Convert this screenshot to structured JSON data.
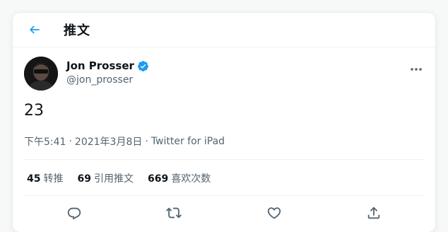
{
  "header": {
    "title": "推文"
  },
  "author": {
    "display_name": "Jon Prosser",
    "handle": "@jon_prosser",
    "verified": true
  },
  "tweet": {
    "text": "23",
    "time": "下午5:41",
    "date": "2021年3月8日",
    "source": "Twitter for iPad",
    "separator": "·"
  },
  "stats": {
    "retweets": {
      "count": "45",
      "label": "转推"
    },
    "quotes": {
      "count": "69",
      "label": "引用推文"
    },
    "likes": {
      "count": "669",
      "label": "喜欢次数"
    }
  },
  "icons": {
    "back": "back-arrow-icon",
    "verified": "verified-badge-icon",
    "more": "more-icon",
    "reply": "reply-icon",
    "retweet": "retweet-icon",
    "like": "heart-icon",
    "share": "share-icon"
  },
  "colors": {
    "accent": "#1d9bf0",
    "text": "#0f1419",
    "muted": "#536471",
    "border": "#eff3f4"
  }
}
